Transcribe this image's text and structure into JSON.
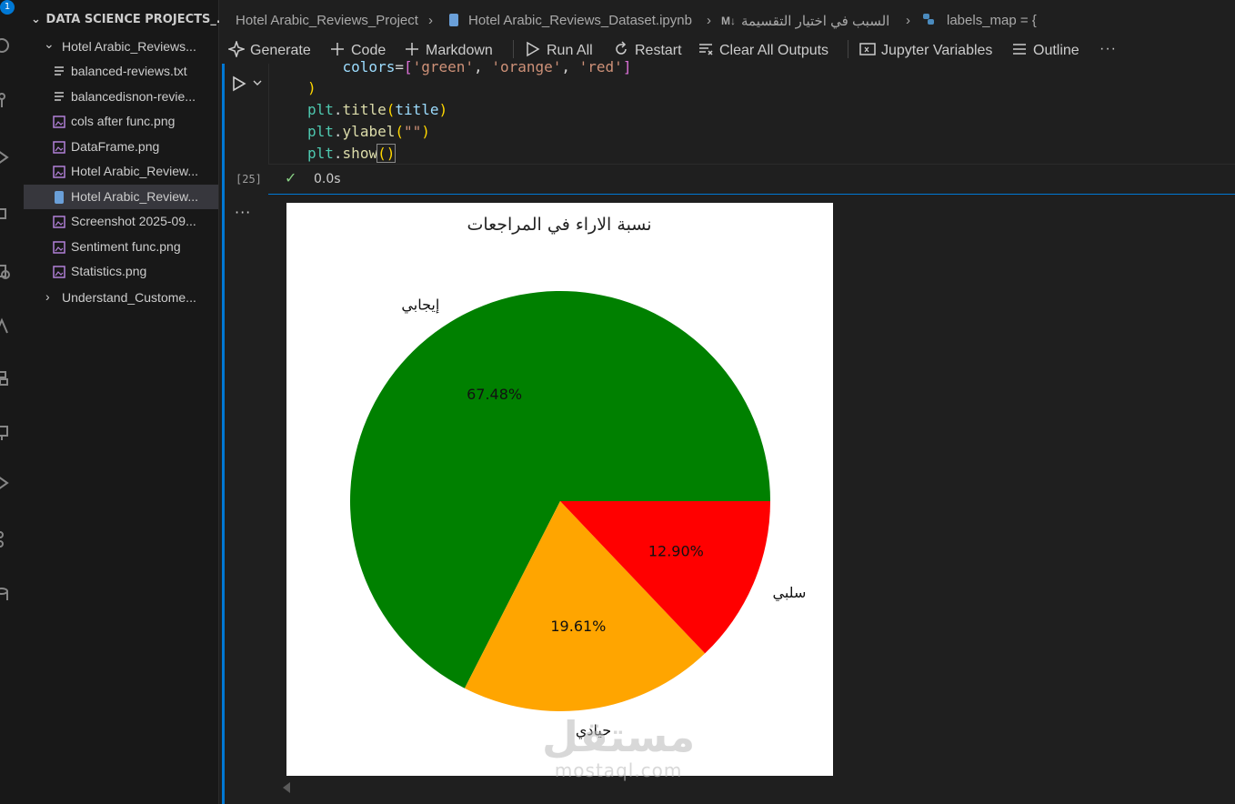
{
  "activity_bar": {
    "badge": "1"
  },
  "explorer": {
    "root_label": "DATA SCIENCE PROJECTS_...",
    "folder_label": "Hotel Arabic_Reviews...",
    "items": [
      {
        "label": "balanced-reviews.txt",
        "icon": "text-file-icon"
      },
      {
        "label": "balancedisnon-revie...",
        "icon": "text-file-icon"
      },
      {
        "label": "cols after func.png",
        "icon": "image-file-icon"
      },
      {
        "label": "DataFrame.png",
        "icon": "image-file-icon"
      },
      {
        "label": "Hotel Arabic_Review...",
        "icon": "image-file-icon"
      },
      {
        "label": "Hotel Arabic_Review...",
        "icon": "notebook-file-icon"
      },
      {
        "label": "Screenshot 2025-09...",
        "icon": "image-file-icon"
      },
      {
        "label": "Sentiment func.png",
        "icon": "image-file-icon"
      },
      {
        "label": "Statistics.png",
        "icon": "image-file-icon"
      }
    ],
    "sibling_folder_label": "Understand_Custome..."
  },
  "breadcrumb": {
    "project": "Hotel Arabic_Reviews_Project",
    "notebook": "Hotel Arabic_Reviews_Dataset.ipynb",
    "markdown_badge": "M↓",
    "section": "السبب في اختيار التقسيمة",
    "symbol": "labels_map = {"
  },
  "toolbar": {
    "generate": "Generate",
    "code": "Code",
    "markdown": "Markdown",
    "run_all": "Run All",
    "restart": "Restart",
    "clear_outputs": "Clear All Outputs",
    "variables": "Jupyter Variables",
    "outline": "Outline",
    "more": "···"
  },
  "cell": {
    "lines": [
      "    colors=['green', 'orange', 'red']",
      ")",
      "plt.title(title)",
      "plt.ylabel(\"\")",
      "plt.show()"
    ],
    "execution_count": "[25]",
    "status_check": "✓",
    "duration": "0.0s",
    "output_menu": "···"
  },
  "colors": {
    "positive": "#008000",
    "neutral": "#ffa500",
    "negative": "#ff0000",
    "accent": "#0078d4"
  },
  "chart_data": {
    "type": "pie",
    "title": "نسبة الاراء في المراجعات",
    "categories": [
      "إيجابي",
      "حيادي",
      "سلبي"
    ],
    "values": [
      67.48,
      19.61,
      12.9
    ],
    "value_labels": [
      "67.48%",
      "19.61%",
      "12.90%"
    ],
    "colors": [
      "green",
      "orange",
      "red"
    ],
    "ylabel": ""
  },
  "watermark": {
    "brand": "مستقل",
    "domain": "mostaql.com"
  }
}
